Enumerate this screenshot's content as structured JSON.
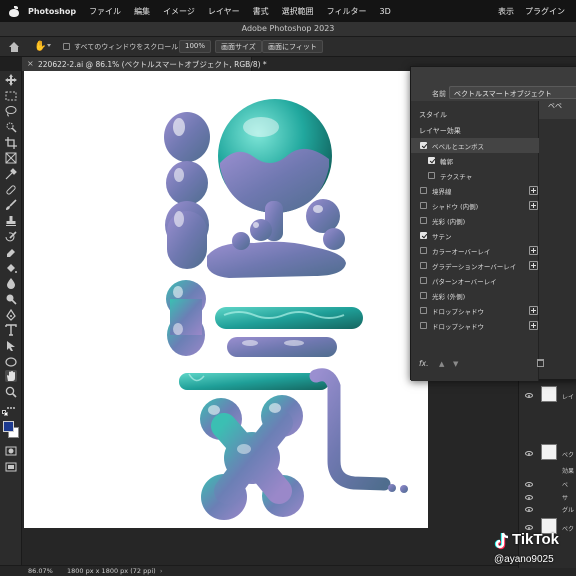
{
  "menubar": {
    "app": "Photoshop",
    "items": [
      "ファイル",
      "編集",
      "イメージ",
      "レイヤー",
      "書式",
      "選択範囲",
      "フィルター",
      "3D"
    ],
    "right_items": [
      "表示",
      "プラグイン"
    ]
  },
  "window": {
    "title": "Adobe Photoshop 2023"
  },
  "options": {
    "scroll_all_label": "すべてのウィンドウをスクロール",
    "zoom_button": "100%",
    "fit_screen_button": "画面サイズ",
    "fill_screen_button": "画面にフィット"
  },
  "document": {
    "tab_title": "220622-2.ai @ 86.1% (ベクトルスマートオブジェクト, RGB/8) *"
  },
  "status": {
    "zoom": "86.07%",
    "size": "1800 px x 1800 px (72 ppi)"
  },
  "dialog": {
    "name_label": "名前 :",
    "name_value": "ベクトルスマートオブジェクト",
    "right_label": "ベベ",
    "rows": [
      {
        "label": "スタイル",
        "type": "head"
      },
      {
        "label": "レイヤー効果",
        "type": "head"
      },
      {
        "label": "ベベルとエンボス",
        "checked": true,
        "selected": true
      },
      {
        "label": "輪郭",
        "checked": true,
        "sub": true
      },
      {
        "label": "テクスチャ",
        "checked": false,
        "sub": true
      },
      {
        "label": "境界線",
        "checked": false,
        "plus": true
      },
      {
        "label": "シャドウ (内側)",
        "checked": false,
        "plus": true
      },
      {
        "label": "光彩 (内側)",
        "checked": false
      },
      {
        "label": "サテン",
        "checked": true
      },
      {
        "label": "カラーオーバーレイ",
        "checked": false,
        "plus": true
      },
      {
        "label": "グラデーションオーバーレイ",
        "checked": false,
        "plus": true
      },
      {
        "label": "パターンオーバーレイ",
        "checked": false
      },
      {
        "label": "光彩 (外側)",
        "checked": false
      },
      {
        "label": "ドロップシャドウ",
        "checked": false,
        "plus": true
      },
      {
        "label": "ドロップシャドウ",
        "checked": false,
        "plus": true
      }
    ],
    "fx_label": "fx."
  },
  "layers": {
    "rows": [
      {
        "label": "レイ"
      },
      {
        "label": "ベク"
      },
      {
        "label": "効果"
      },
      {
        "label": "ベ"
      },
      {
        "label": "サ"
      },
      {
        "label": "グル"
      },
      {
        "label": "ベク"
      }
    ]
  },
  "watermark": {
    "brand": "TikTok",
    "handle": "@ayano9025"
  },
  "colors": {
    "menubar_bg": "#141414",
    "panel_bg": "#2f2f2f",
    "teal": "#1fa39a",
    "lavender": "#8c86c4",
    "foreground_swatch": "#1d3a8f"
  }
}
